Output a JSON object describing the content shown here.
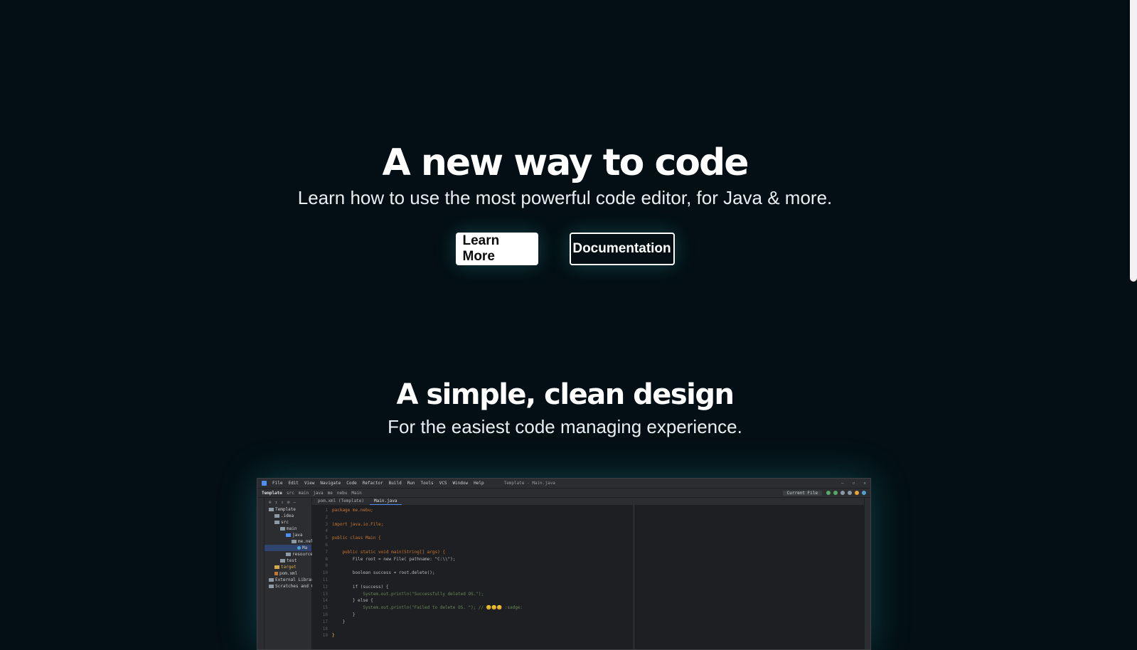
{
  "hero": {
    "title": "A new way to code",
    "subtitle": "Learn how to use the most powerful code editor, for Java & more.",
    "learn_more_label": "Learn More",
    "documentation_label": "Documentation"
  },
  "section": {
    "title": "A simple, clean design",
    "subtitle": "For the easiest code managing experience."
  },
  "ide": {
    "menu": [
      "File",
      "Edit",
      "View",
      "Navigate",
      "Code",
      "Refactor",
      "Build",
      "Run",
      "Tools",
      "VCS",
      "Window",
      "Help"
    ],
    "window_title": "Template - Main.java",
    "project_name": "Template",
    "breadcrumbs": [
      "src",
      "main",
      "java",
      "me",
      "nebu",
      "Main"
    ],
    "run_config": "Current File",
    "tabs": [
      "pom.xml (Template)",
      "Main.java"
    ],
    "tree": [
      "Template",
      ".idea",
      "src",
      "main",
      "java",
      "me.nel",
      "Ma",
      "resources",
      "test",
      "target",
      "pom.xml",
      "External Libraries",
      "Scratches and Cons"
    ],
    "line_numbers": [
      "1",
      "2",
      "3",
      "4",
      "5",
      "6",
      "7",
      "8",
      "9",
      "10",
      "11",
      "12",
      "13",
      "14",
      "15",
      "16",
      "17",
      "18",
      "19"
    ],
    "code": {
      "l1": "package me.nebu;",
      "l3": "import java.io.File;",
      "l5": "public class Main {",
      "l7": "    public static void main(String[] args) {",
      "l8": "        File root = new File( pathname: \"C:\\\\\");",
      "l10": "        boolean success = root.delete();",
      "l12": "        if (success) {",
      "l13": "            System.out.println(\"Successfully deleted OS.\");",
      "l14": "        } else {",
      "l15": "            System.out.println(\"Failed to delete OS. \"); // 😊😊😊 :sadge:",
      "l16": "        }",
      "l17": "    }",
      "l19": "}"
    }
  },
  "colors": {
    "background": "#030f14",
    "button_primary_bg": "#ffffff",
    "glow": "#3cbed2"
  }
}
